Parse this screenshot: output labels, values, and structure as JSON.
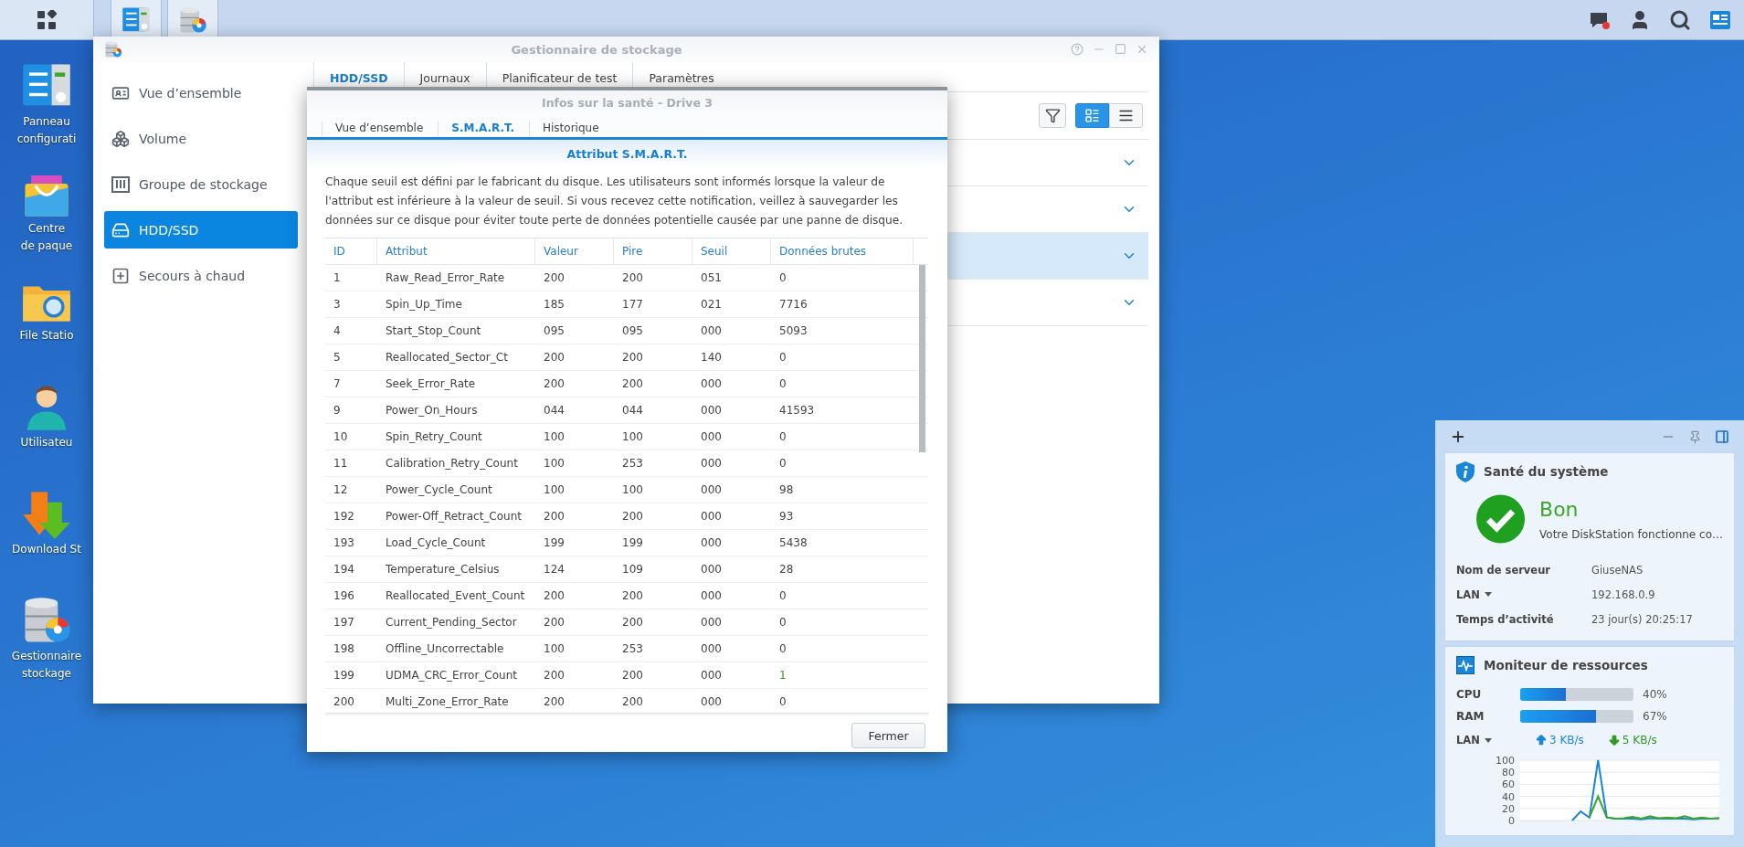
{
  "taskbar": {
    "apps": [
      {
        "kind": "control-panel"
      },
      {
        "kind": "storage"
      }
    ],
    "tray": [
      {
        "kind": "chat"
      },
      {
        "kind": "user"
      },
      {
        "kind": "search"
      },
      {
        "kind": "widgets"
      }
    ]
  },
  "desktop_icons": [
    {
      "kind": "control-panel",
      "label_lines": [
        "Panneau",
        "configurati"
      ]
    },
    {
      "kind": "package",
      "label_lines": [
        "Centre",
        "de paque"
      ]
    },
    {
      "kind": "file-station",
      "label_lines": [
        "File Statio"
      ]
    },
    {
      "kind": "user",
      "label_lines": [
        "Utilisateu"
      ]
    },
    {
      "kind": "download",
      "label_lines": [
        "Download St"
      ]
    },
    {
      "kind": "storage",
      "label_lines": [
        "Gestionnaire",
        "stockage"
      ]
    }
  ],
  "storage_window": {
    "title": "Gestionnaire de stockage",
    "sidebar": [
      {
        "kind": "overview",
        "label": "Vue d’ensemble",
        "selected": false
      },
      {
        "kind": "volume",
        "label": "Volume",
        "selected": false
      },
      {
        "kind": "pool",
        "label": "Groupe de stockage",
        "selected": false
      },
      {
        "kind": "disk",
        "label": "HDD/SSD",
        "selected": true
      },
      {
        "kind": "spare",
        "label": "Secours à chaud",
        "selected": false
      }
    ],
    "tabs": [
      {
        "label": "HDD/SSD",
        "selected": true
      },
      {
        "label": "Journaux",
        "selected": false
      },
      {
        "label": "Planificateur de test",
        "selected": false
      },
      {
        "label": "Paramètres",
        "selected": false
      }
    ],
    "view_modes": [
      {
        "kind": "detail",
        "selected": true
      },
      {
        "kind": "list",
        "selected": false
      }
    ],
    "disk_rows": [
      {
        "selected": false
      },
      {
        "selected": false
      },
      {
        "selected": true
      },
      {
        "selected": false
      }
    ]
  },
  "health_dialog": {
    "title": "Infos sur la santé - Drive 3",
    "tabs": [
      {
        "label": "Vue d’ensemble",
        "selected": false
      },
      {
        "label": "S.M.A.R.T.",
        "selected": true
      },
      {
        "label": "Historique",
        "selected": false
      }
    ],
    "section_title": "Attribut S.M.A.R.T.",
    "description": "Chaque seuil est défini par le fabricant du disque. Les utilisateurs sont informés lorsque la valeur de l'attribut est inférieure à la valeur de seuil. Si vous recevez cette notification, veillez à sauvegarder les données sur ce disque pour éviter toute perte de données potentielle causée par une panne de disque.",
    "columns": [
      "ID",
      "Attribut",
      "Valeur",
      "Pire",
      "Seuil",
      "Données brutes"
    ],
    "rows": [
      {
        "cells": [
          "1",
          "Raw_Read_Error_Rate",
          "200",
          "200",
          "051",
          "0"
        ],
        "raw_highlighted": false
      },
      {
        "cells": [
          "3",
          "Spin_Up_Time",
          "185",
          "177",
          "021",
          "7716"
        ],
        "raw_highlighted": false
      },
      {
        "cells": [
          "4",
          "Start_Stop_Count",
          "095",
          "095",
          "000",
          "5093"
        ],
        "raw_highlighted": false
      },
      {
        "cells": [
          "5",
          "Reallocated_Sector_Ct",
          "200",
          "200",
          "140",
          "0"
        ],
        "raw_highlighted": false
      },
      {
        "cells": [
          "7",
          "Seek_Error_Rate",
          "200",
          "200",
          "000",
          "0"
        ],
        "raw_highlighted": false
      },
      {
        "cells": [
          "9",
          "Power_On_Hours",
          "044",
          "044",
          "000",
          "41593"
        ],
        "raw_highlighted": false
      },
      {
        "cells": [
          "10",
          "Spin_Retry_Count",
          "100",
          "100",
          "000",
          "0"
        ],
        "raw_highlighted": false
      },
      {
        "cells": [
          "11",
          "Calibration_Retry_Count",
          "100",
          "253",
          "000",
          "0"
        ],
        "raw_highlighted": false
      },
      {
        "cells": [
          "12",
          "Power_Cycle_Count",
          "100",
          "100",
          "000",
          "98"
        ],
        "raw_highlighted": false
      },
      {
        "cells": [
          "192",
          "Power-Off_Retract_Count",
          "200",
          "200",
          "000",
          "93"
        ],
        "raw_highlighted": false
      },
      {
        "cells": [
          "193",
          "Load_Cycle_Count",
          "199",
          "199",
          "000",
          "5438"
        ],
        "raw_highlighted": false
      },
      {
        "cells": [
          "194",
          "Temperature_Celsius",
          "124",
          "109",
          "000",
          "28"
        ],
        "raw_highlighted": false
      },
      {
        "cells": [
          "196",
          "Reallocated_Event_Count",
          "200",
          "200",
          "000",
          "0"
        ],
        "raw_highlighted": false
      },
      {
        "cells": [
          "197",
          "Current_Pending_Sector",
          "200",
          "200",
          "000",
          "0"
        ],
        "raw_highlighted": false
      },
      {
        "cells": [
          "198",
          "Offline_Uncorrectable",
          "100",
          "253",
          "000",
          "0"
        ],
        "raw_highlighted": false
      },
      {
        "cells": [
          "199",
          "UDMA_CRC_Error_Count",
          "200",
          "200",
          "000",
          "1"
        ],
        "raw_highlighted": true
      },
      {
        "cells": [
          "200",
          "Multi_Zone_Error_Rate",
          "200",
          "200",
          "000",
          "0"
        ],
        "raw_highlighted": false
      }
    ],
    "close_button": "Fermer"
  },
  "widgets": {
    "health": {
      "title": "Santé du système",
      "status": "Bon",
      "message": "Votre DiskStation fonctionne co…",
      "info": [
        {
          "label": "Nom de serveur",
          "value": "GiuseNAS",
          "dropdown": false
        },
        {
          "label": "LAN",
          "value": "192.168.0.9",
          "dropdown": true
        },
        {
          "label": "Temps d’activité",
          "value": "23 jour(s) 20:25:17",
          "dropdown": false
        }
      ]
    },
    "resources": {
      "title": "Moniteur de ressources",
      "meters": [
        {
          "label": "CPU",
          "level": 0.4,
          "reading": "40%"
        },
        {
          "label": "RAM",
          "level": 0.67,
          "reading": "67%"
        }
      ],
      "network": {
        "label": "LAN",
        "upload": "3 KB/s",
        "download": "5 KB/s"
      },
      "chart_data": {
        "type": "line",
        "grid": true,
        "ylim": [
          0,
          100
        ],
        "yticks": [
          0,
          20,
          40,
          60,
          80,
          100
        ],
        "series": [
          {
            "color": "#1a86d8",
            "values": [
              null,
              null,
              null,
              null,
              null,
              null,
              0,
              15,
              5,
              100,
              5,
              3,
              3,
              3,
              2,
              4,
              3,
              3,
              3,
              3,
              2,
              3,
              3,
              4
            ]
          },
          {
            "color": "#3aa62b",
            "values": [
              null,
              null,
              null,
              null,
              null,
              null,
              null,
              null,
              5,
              40,
              5,
              3,
              4,
              6,
              3,
              7,
              4,
              5,
              4,
              7,
              3,
              5,
              3,
              4
            ]
          }
        ]
      }
    }
  }
}
